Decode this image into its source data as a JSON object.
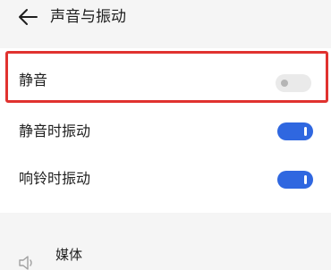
{
  "header": {
    "back_icon": "arrow-left-icon",
    "title": "声音与振动"
  },
  "settings": {
    "mute": {
      "label": "静音",
      "enabled": false
    },
    "vibrate_on_mute": {
      "label": "静音时振动",
      "enabled": true
    },
    "vibrate_on_ring": {
      "label": "响铃时振动",
      "enabled": true
    }
  },
  "media": {
    "icon": "speaker-icon",
    "label": "媒体"
  },
  "colors": {
    "accent": "#2f67e0",
    "highlight": "#e0322f",
    "toggle_off": "#eaeaea",
    "background": "#f5f5f5",
    "card": "#ffffff"
  }
}
